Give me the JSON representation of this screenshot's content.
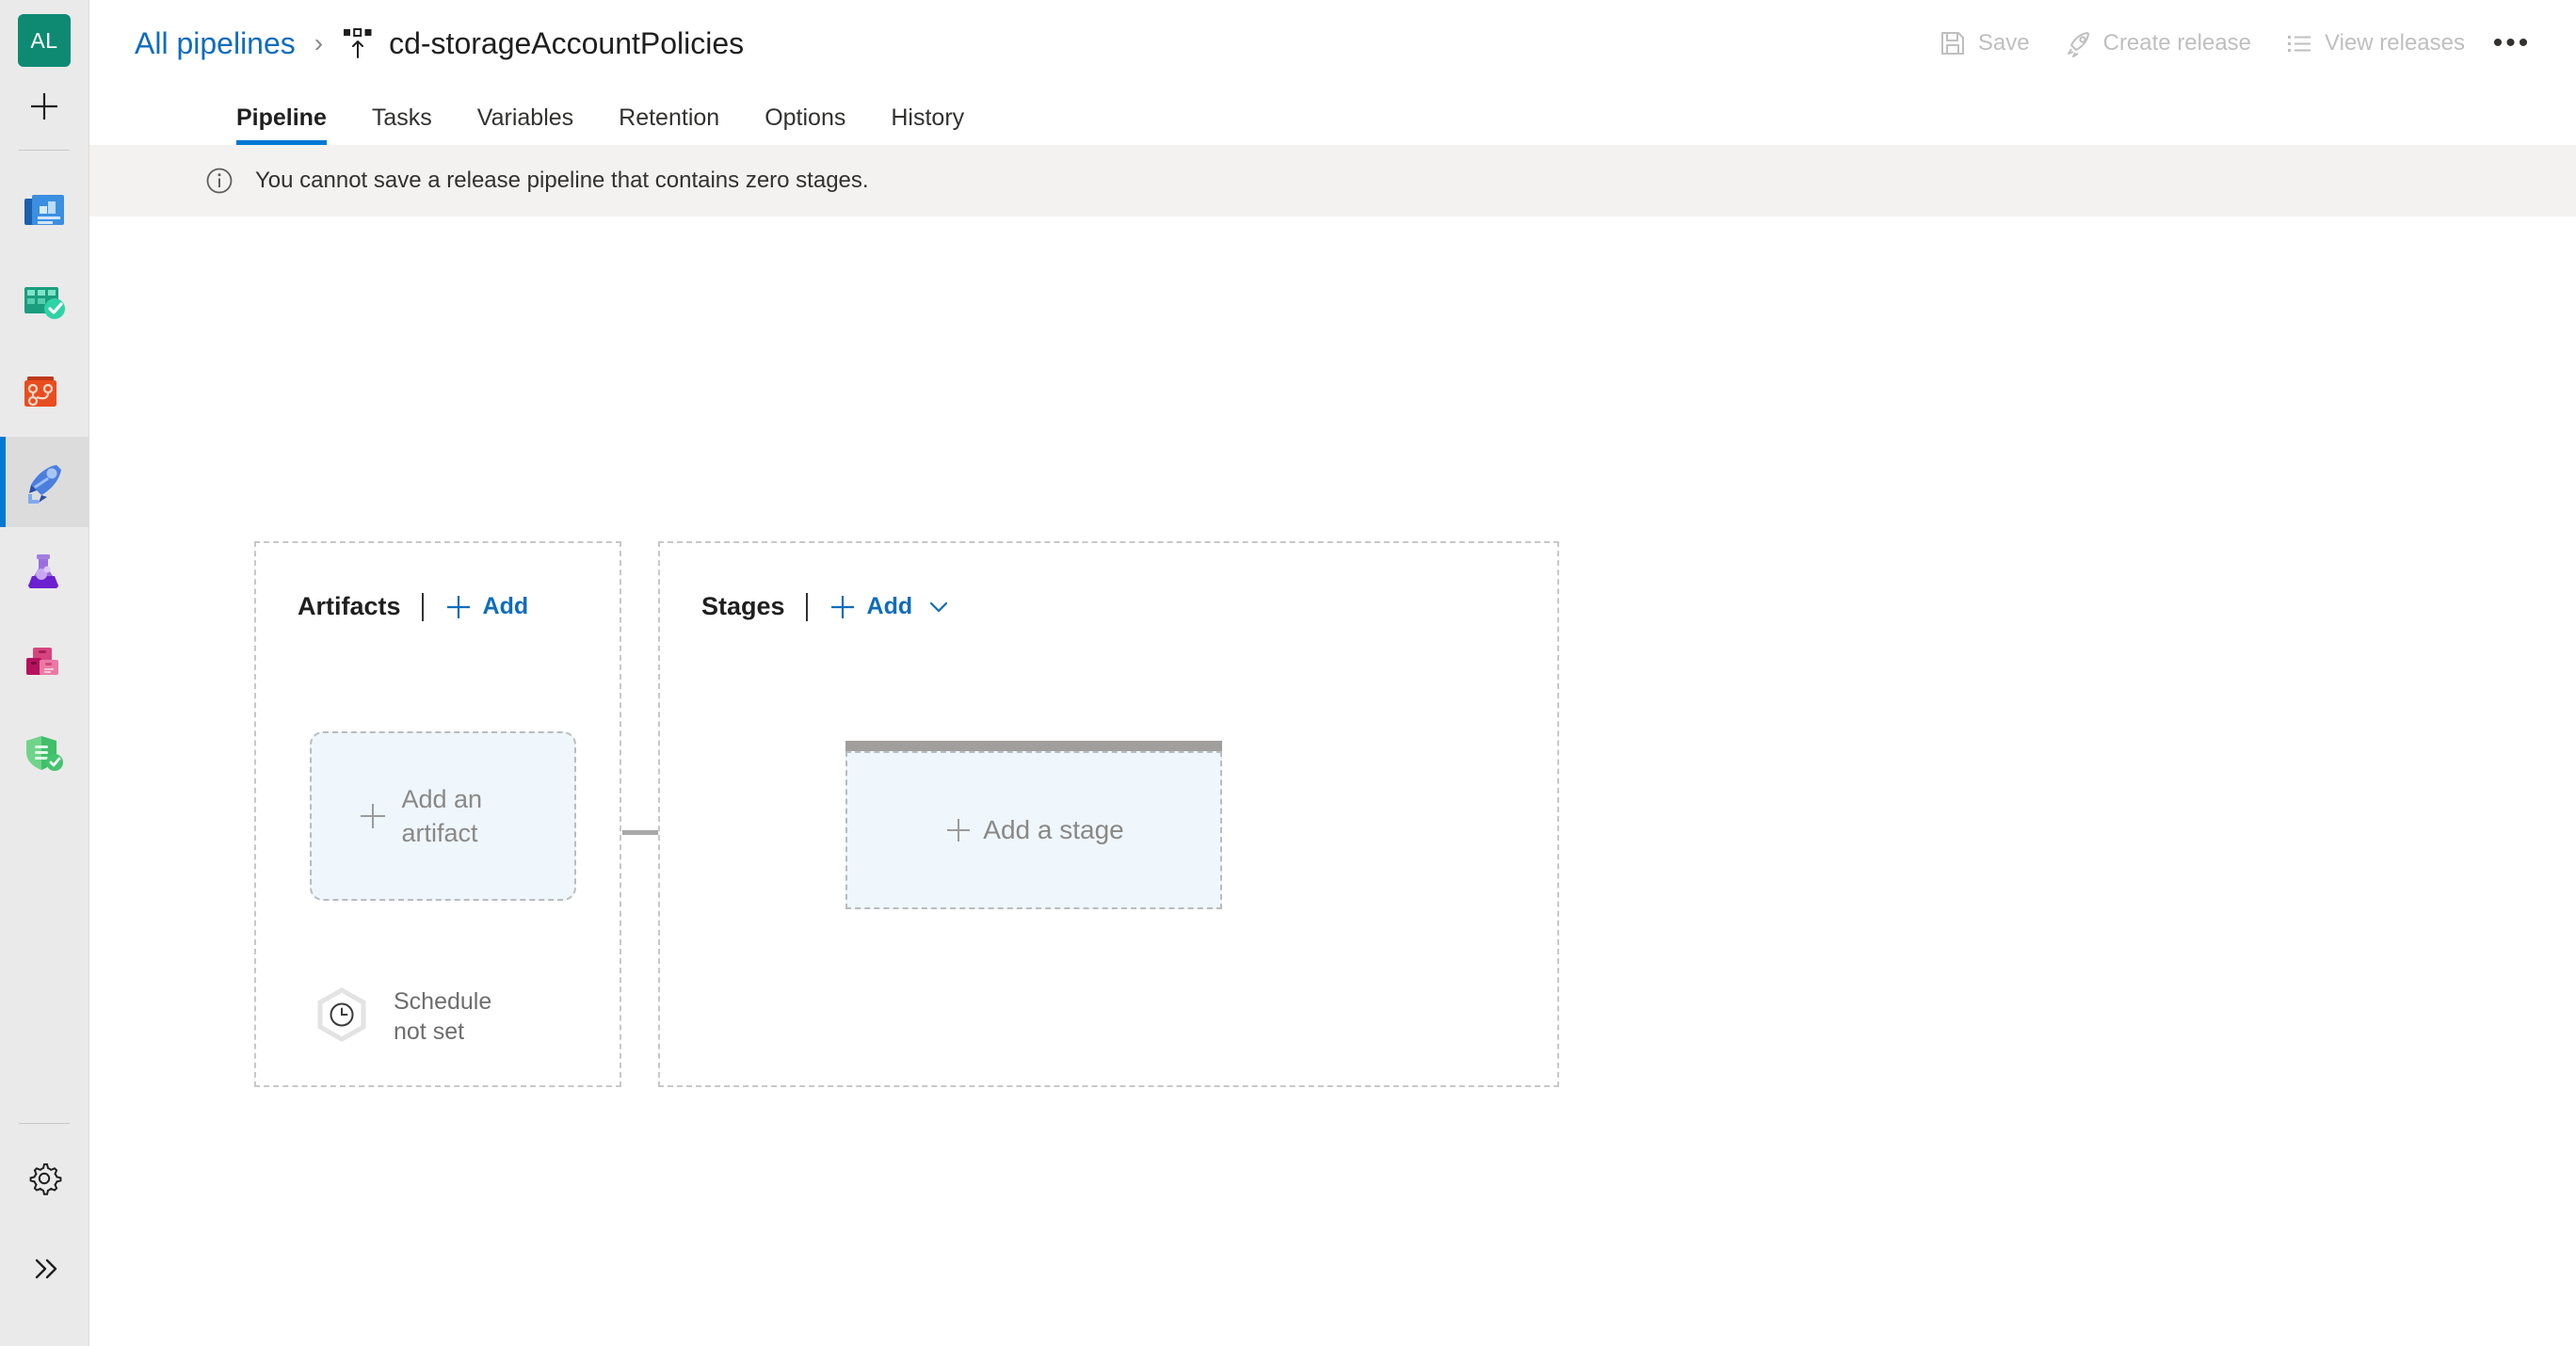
{
  "sidebar": {
    "avatar": {
      "initials": "AL",
      "color": "#0e8a72"
    },
    "add_icon": "plus-icon",
    "items": [
      {
        "name": "overview",
        "icon": "overview-icon",
        "selected": false
      },
      {
        "name": "boards",
        "icon": "boards-icon",
        "selected": false
      },
      {
        "name": "repos",
        "icon": "repos-icon",
        "selected": false
      },
      {
        "name": "pipelines",
        "icon": "pipelines-rocket-icon",
        "selected": true
      },
      {
        "name": "test-plans",
        "icon": "test-plans-flask-icon",
        "selected": false
      },
      {
        "name": "artifacts",
        "icon": "artifacts-boxes-icon",
        "selected": false
      },
      {
        "name": "advanced-security",
        "icon": "shield-check-icon",
        "selected": false
      }
    ],
    "bottom": [
      {
        "name": "settings",
        "icon": "gear-icon"
      },
      {
        "name": "expand",
        "icon": "double-chevron-right-icon"
      }
    ],
    "selection_color": "#0078d4"
  },
  "header": {
    "breadcrumb_link": "All pipelines",
    "breadcrumb_separator": "›",
    "title_icon": "release-pipeline-icon",
    "title": "cd-storageAccountPolicies",
    "actions": [
      {
        "label": "Save",
        "icon": "save-disk-icon",
        "disabled": true
      },
      {
        "label": "Create release",
        "icon": "rocket-icon",
        "disabled": true
      },
      {
        "label": "View releases",
        "icon": "list-lines-icon",
        "disabled": true
      }
    ],
    "overflow_label": "•••",
    "link_color": "#0f6cbd",
    "disabled_color": "#bfbfbf"
  },
  "tabs": [
    {
      "label": "Pipeline",
      "active": true
    },
    {
      "label": "Tasks",
      "active": false
    },
    {
      "label": "Variables",
      "active": false
    },
    {
      "label": "Retention",
      "active": false
    },
    {
      "label": "Options",
      "active": false
    },
    {
      "label": "History",
      "active": false
    }
  ],
  "banner": {
    "icon": "info-circle-icon",
    "message": "You cannot save a release pipeline that contains zero stages.",
    "background": "#f3f2f1"
  },
  "artifacts_panel": {
    "title": "Artifacts",
    "add_label": "Add",
    "add_icon": "plus-icon",
    "add_artifact_label": "Add an artifact",
    "add_artifact_icon": "plus-icon",
    "schedule_icon": "clock-hexagon-icon",
    "schedule_label_line1": "Schedule",
    "schedule_label_line2": "not set"
  },
  "stages_panel": {
    "title": "Stages",
    "add_label": "Add",
    "add_icon": "plus-icon",
    "dropdown_icon": "chevron-down-icon",
    "add_stage_label": "Add a stage",
    "add_stage_icon": "plus-icon"
  },
  "colors": {
    "accent": "#0078d4",
    "link": "#0f6cbd",
    "box_fill": "#eff6fc",
    "dash_border": "#c8c8c8",
    "muted_text": "#8a8886",
    "stage_topbar": "#a19f9d"
  }
}
